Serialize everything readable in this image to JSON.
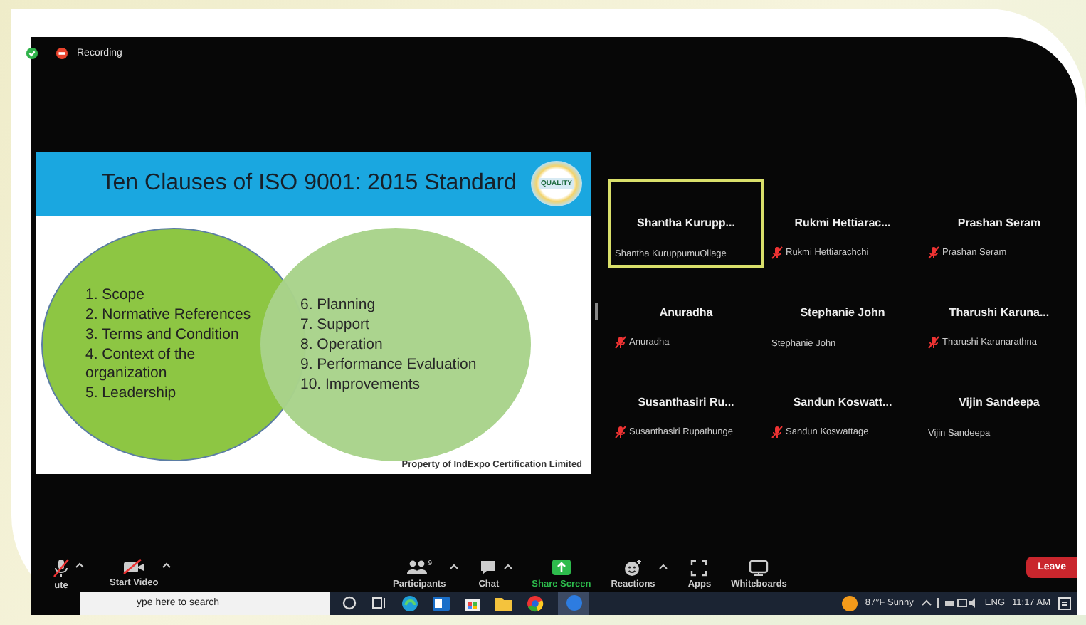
{
  "recording": {
    "label": "Recording"
  },
  "slide": {
    "title": "Ten Clauses of ISO 9001: 2015 Standard",
    "logo_text": "QUALITY",
    "left_items": [
      "1. Scope",
      "2. Normative References",
      "3. Terms and Condition",
      "4. Context of the organization",
      "5. Leadership"
    ],
    "right_items": [
      "6. Planning",
      "7. Support",
      "8. Operation",
      "9. Performance Evaluation",
      "10. Improvements"
    ],
    "footer": "Property of IndExpo Certification Limited"
  },
  "participants": [
    {
      "display_name": "Shantha  Kurupp...",
      "name": "Shantha KuruppumuOllage",
      "muted": false,
      "selected": true
    },
    {
      "display_name": "Rukmi  Hettiarac...",
      "name": "Rukmi Hettiarachchi",
      "muted": true,
      "selected": false
    },
    {
      "display_name": "Prashan Seram",
      "name": "Prashan Seram",
      "muted": true,
      "selected": false
    },
    {
      "display_name": "Anuradha",
      "name": "Anuradha",
      "muted": true,
      "selected": false
    },
    {
      "display_name": "Stephanie John",
      "name": "Stephanie John",
      "muted": false,
      "selected": false
    },
    {
      "display_name": "Tharushi  Karuna...",
      "name": "Tharushi Karunarathna",
      "muted": true,
      "selected": false
    },
    {
      "display_name": "Susanthasiri  Ru...",
      "name": "Susanthasiri Rupathunge",
      "muted": true,
      "selected": false
    },
    {
      "display_name": "Sandun  Koswatt...",
      "name": "Sandun Koswattage",
      "muted": true,
      "selected": false
    },
    {
      "display_name": "Vijin Sandeepa",
      "name": "Vijin Sandeepa",
      "muted": false,
      "selected": false
    }
  ],
  "toolbar_left": [
    {
      "kind": "mic",
      "label": "ute",
      "caret": true
    },
    {
      "kind": "video",
      "label": "Start Video",
      "caret": true
    }
  ],
  "toolbar_center": [
    {
      "kind": "participants",
      "label": "Participants",
      "count": "9",
      "caret": true
    },
    {
      "kind": "chat",
      "label": "Chat",
      "caret": true
    },
    {
      "kind": "share",
      "label": "Share Screen",
      "caret": false
    },
    {
      "kind": "reactions",
      "label": "Reactions",
      "caret": true
    },
    {
      "kind": "apps",
      "label": "Apps",
      "caret": false
    },
    {
      "kind": "whiteboards",
      "label": "Whiteboards",
      "caret": false
    }
  ],
  "leave": {
    "label": "Leave"
  },
  "taskbar": {
    "search_placeholder": "ype here to search",
    "weather": "87°F  Sunny",
    "language": "ENG",
    "time": "11:17 AM"
  }
}
